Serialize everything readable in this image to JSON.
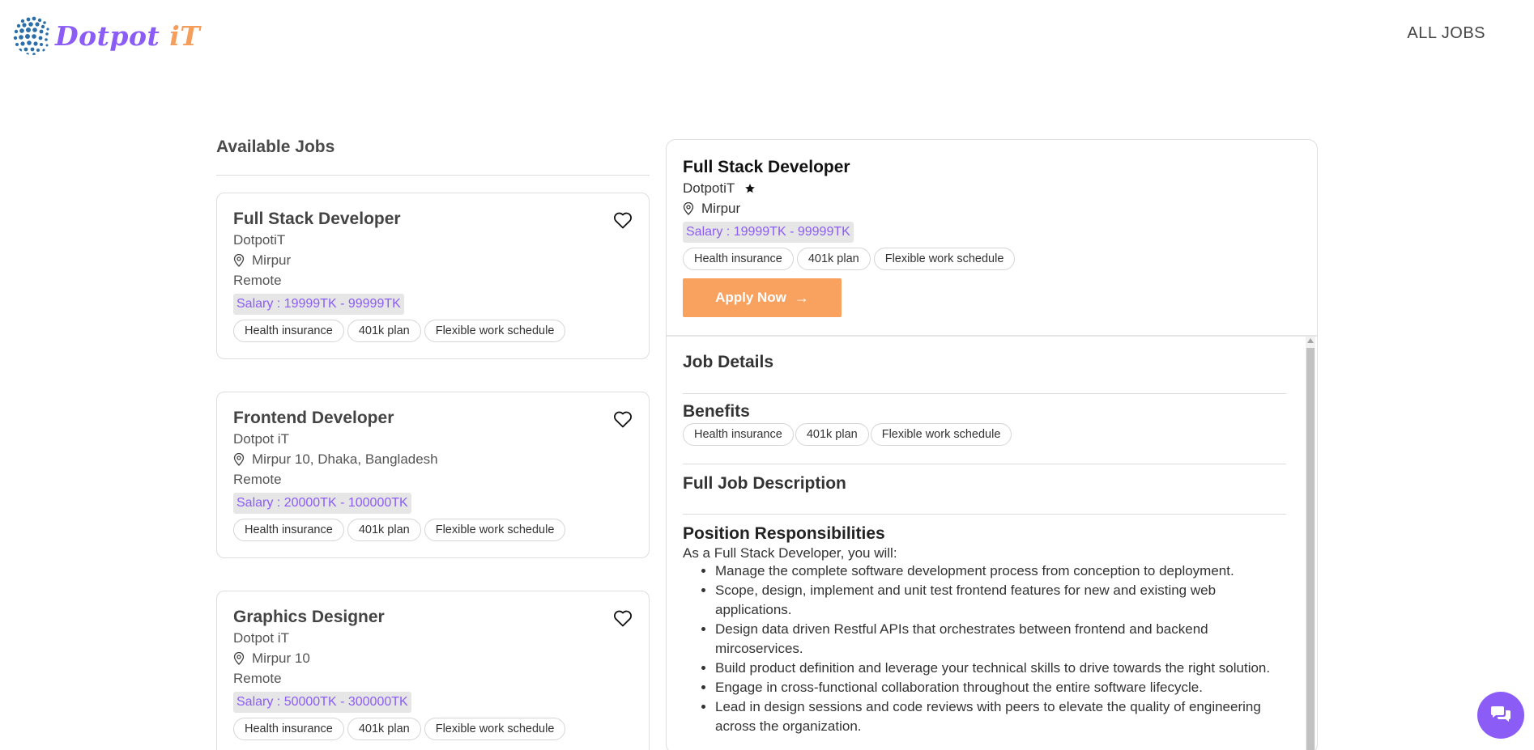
{
  "header": {
    "logo_part1": "Dotpot ",
    "logo_part2": "iT",
    "nav_all_jobs": "ALL JOBS"
  },
  "list": {
    "title": "Available Jobs",
    "jobs": [
      {
        "title": "Full Stack Developer",
        "company": "DotpotiT",
        "location": "Mirpur",
        "mode": "Remote",
        "salary": "Salary : 19999TK - 99999TK",
        "tags": [
          "Health insurance",
          "401k plan",
          "Flexible work schedule"
        ]
      },
      {
        "title": "Frontend Developer",
        "company": "Dotpot iT",
        "location": "Mirpur 10, Dhaka, Bangladesh",
        "mode": "Remote",
        "salary": "Salary : 20000TK - 100000TK",
        "tags": [
          "Health insurance",
          "401k plan",
          "Flexible work schedule"
        ]
      },
      {
        "title": "Graphics Designer",
        "company": "Dotpot iT",
        "location": "Mirpur 10",
        "mode": "Remote",
        "salary": "Salary : 50000TK - 300000TK",
        "tags": [
          "Health insurance",
          "401k plan",
          "Flexible work schedule"
        ]
      }
    ]
  },
  "detail": {
    "title": "Full Stack Developer",
    "company": "DotpotiT",
    "location": "Mirpur",
    "salary": "Salary : 19999TK - 99999TK",
    "tags": [
      "Health insurance",
      "401k plan",
      "Flexible work schedule"
    ],
    "apply_label": "Apply Now",
    "apply_arrow": "→",
    "job_details_heading": "Job Details",
    "benefits_heading": "Benefits",
    "benefits": [
      "Health insurance",
      "401k plan",
      "Flexible work schedule"
    ],
    "full_desc_heading": "Full Job Description",
    "responsibilities_heading": "Position Responsibilities",
    "responsibilities_intro": "As a Full Stack Developer, you will:",
    "responsibilities": [
      "Manage the complete software development process from conception to deployment.",
      "Scope, design, implement and unit test frontend features for new and existing web applications.",
      "Design data driven Restful APIs that orchestrates between frontend and backend mircoservices.",
      "Build product definition and leverage your technical skills to drive towards the right solution.",
      "Engage in cross-functional collaboration throughout the entire software lifecycle.",
      "Lead in design sessions and code reviews with peers to elevate the quality of engineering across the organization."
    ]
  },
  "icons": {
    "heart": "heart-icon",
    "location": "location-pin-icon",
    "star": "star-icon",
    "chat": "chat-icon"
  },
  "colors": {
    "brand_purple": "#8b5cf6",
    "brand_orange": "#f9a15e",
    "salary_bg": "#e6e6e6"
  }
}
